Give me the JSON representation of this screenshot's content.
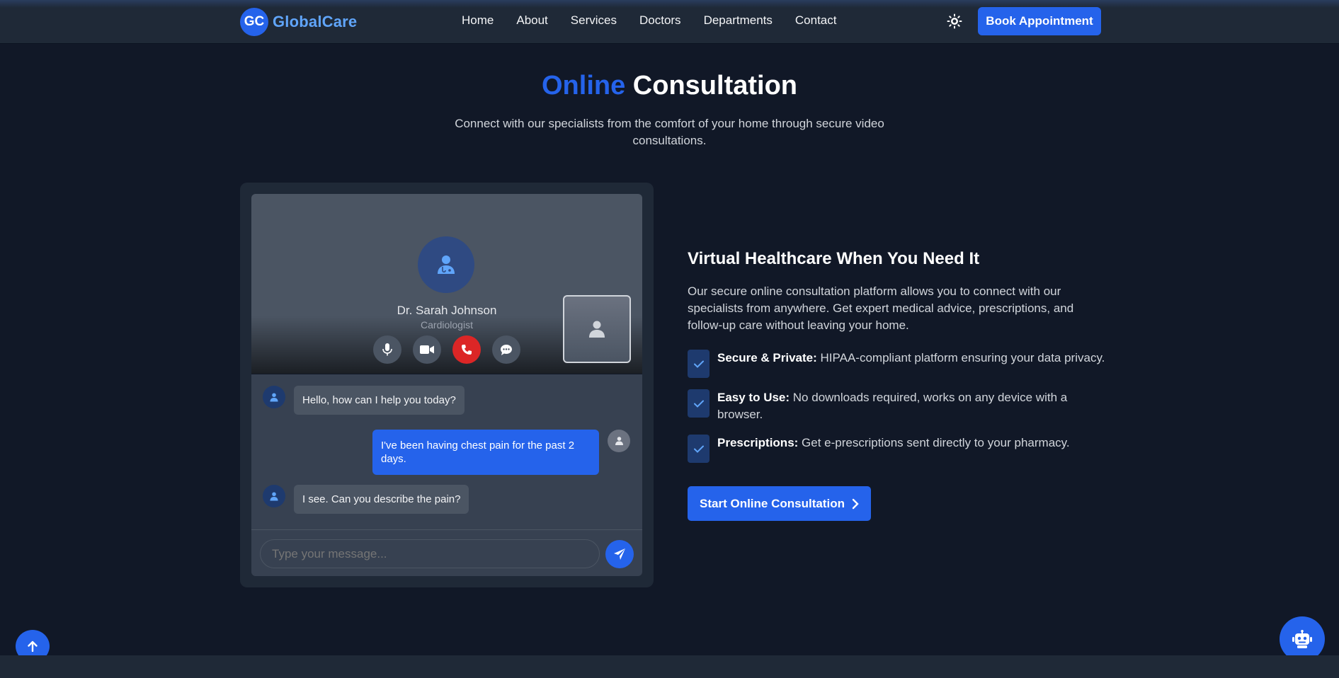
{
  "brand": {
    "logo_text": "GC",
    "name": "GlobalCare"
  },
  "nav": {
    "links": [
      "Home",
      "About",
      "Services",
      "Doctors",
      "Departments",
      "Contact"
    ],
    "theme_icon": "sun-icon",
    "book_label": "Book Appointment"
  },
  "section": {
    "title_accent": "Online",
    "title_rest": "Consultation",
    "subtitle": "Connect with our specialists from the comfort of your home through secure video consultations."
  },
  "call": {
    "doctor_name": "Dr. Sarah Johnson",
    "doctor_specialty": "Cardiologist",
    "controls": [
      "microphone-icon",
      "video-camera-icon",
      "phone-end-icon",
      "chat-icon"
    ]
  },
  "chat": {
    "messages": [
      {
        "from": "doctor",
        "text": "Hello, how can I help you today?"
      },
      {
        "from": "user",
        "text": "I've been having chest pain for the past 2 days."
      },
      {
        "from": "doctor",
        "text": "I see. Can you describe the pain?"
      }
    ],
    "input_placeholder": "Type your message..."
  },
  "info": {
    "title": "Virtual Healthcare When You Need It",
    "description": "Our secure online consultation platform allows you to connect with our specialists from anywhere. Get expert medical advice, prescriptions, and follow-up care without leaving your home.",
    "features": [
      {
        "label": "Secure & Private:",
        "text": "HIPAA-compliant platform ensuring your data privacy."
      },
      {
        "label": "Easy to Use:",
        "text": "No downloads required, works on any device with a browser."
      },
      {
        "label": "Prescriptions:",
        "text": "Get e-prescriptions sent directly to your pharmacy."
      }
    ],
    "cta_label": "Start Online Consultation"
  },
  "colors": {
    "accent": "#2563eb",
    "background": "#111827",
    "card": "#1f2937",
    "end_call": "#dc2626"
  }
}
